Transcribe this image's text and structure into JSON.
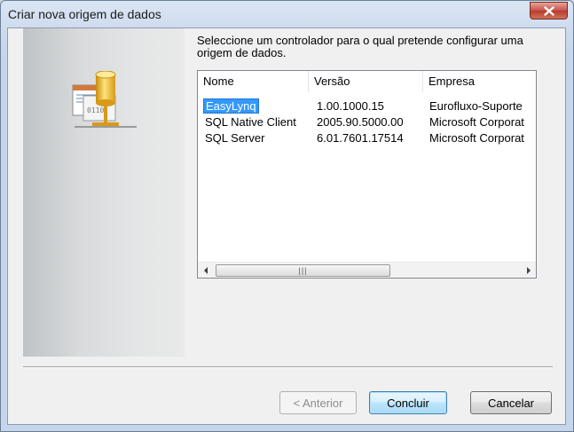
{
  "window": {
    "title": "Criar nova origem de dados"
  },
  "prompt": {
    "text": "Seleccione um controlador para o qual pretende configurar uma origem de dados."
  },
  "list": {
    "columns": [
      "Nome",
      "Versão",
      "Empresa"
    ],
    "rows": [
      {
        "name": "EasyLynq",
        "version": "1.00.1000.15",
        "company": "Eurofluxo-Suporte",
        "selected": true
      },
      {
        "name": "SQL Native Client",
        "version": "2005.90.5000.00",
        "company": "Microsoft Corporat"
      },
      {
        "name": "SQL Server",
        "version": "6.01.7601.17514",
        "company": "Microsoft Corporat"
      }
    ]
  },
  "buttons": {
    "back": "< Anterior",
    "finish": "Concluir",
    "cancel": "Cancelar"
  },
  "icons": {
    "close": "close-icon",
    "side": "odbc-data-source-icon"
  }
}
